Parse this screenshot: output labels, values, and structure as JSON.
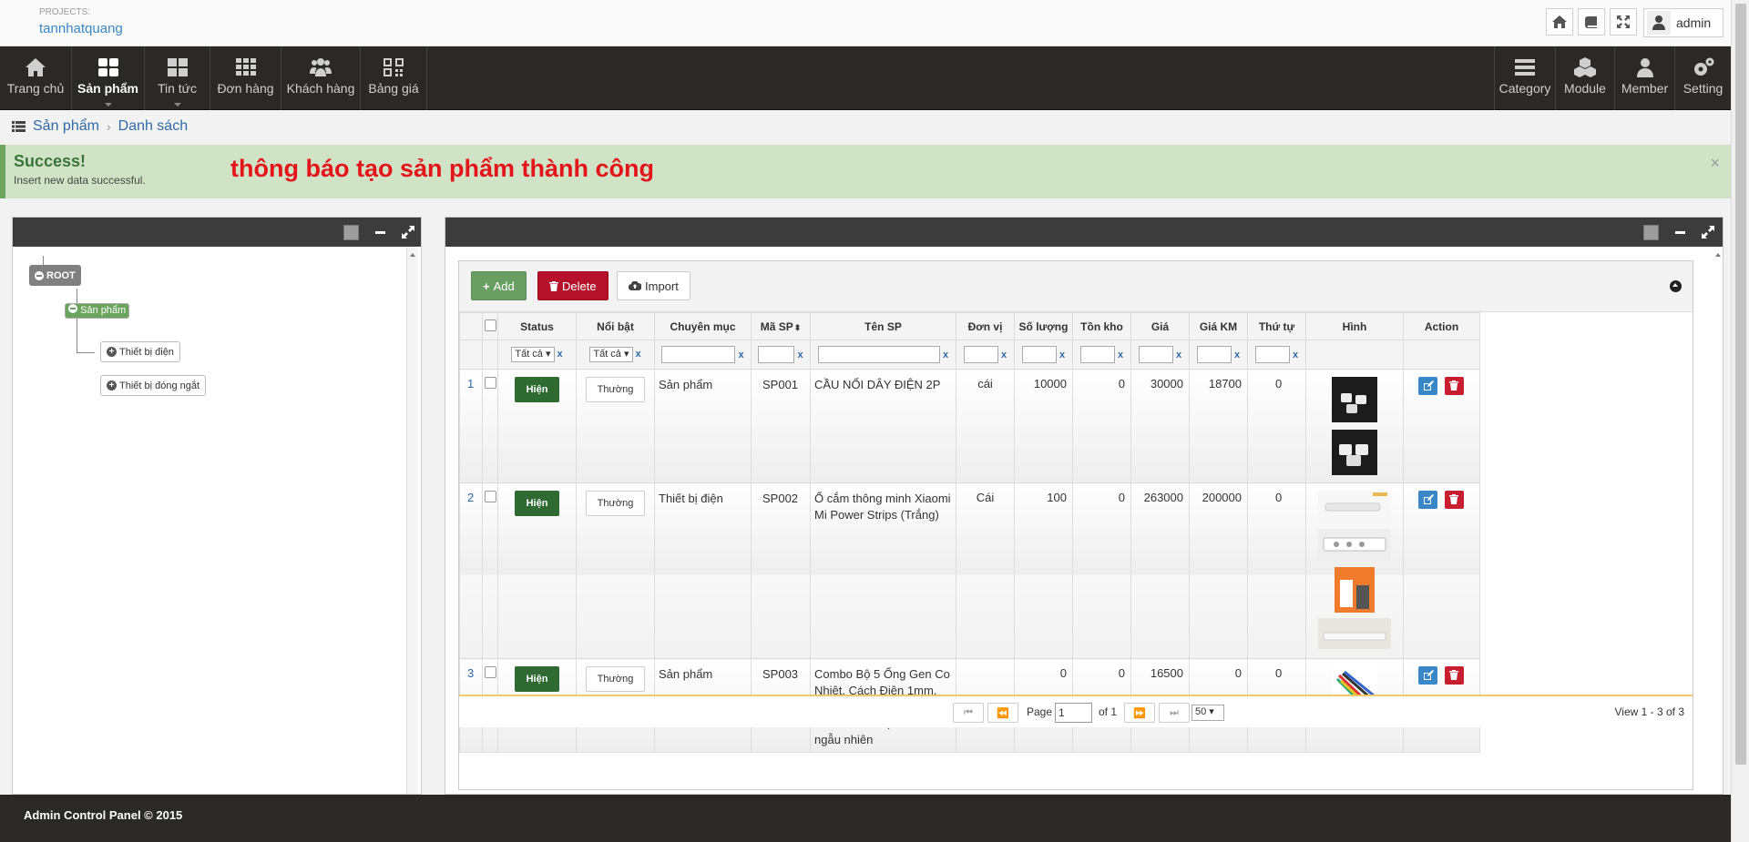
{
  "header": {
    "projects_label": "PROJECTS:",
    "project_name": "tannhatquang",
    "user": "admin"
  },
  "nav": {
    "left": [
      {
        "label": "Trang chủ",
        "icon": "home-icon"
      },
      {
        "label": "Sản phẩm",
        "icon": "dashboard-icon",
        "active": true
      },
      {
        "label": "Tin tức",
        "icon": "grid-icon"
      },
      {
        "label": "Đơn hàng",
        "icon": "apps-icon"
      },
      {
        "label": "Khách hàng",
        "icon": "users-icon"
      },
      {
        "label": "Bảng giá",
        "icon": "qrcode-icon"
      }
    ],
    "right": [
      {
        "label": "Category",
        "icon": "list-icon"
      },
      {
        "label": "Module",
        "icon": "cubes-icon"
      },
      {
        "label": "Member",
        "icon": "user-icon"
      },
      {
        "label": "Setting",
        "icon": "gears-icon"
      }
    ]
  },
  "breadcrumb": {
    "section": "Sản phẩm",
    "page": "Danh sách"
  },
  "alert": {
    "title": "Success!",
    "message": "Insert new data successful.",
    "note": "thông báo tạo sản phẩm thành công",
    "close": "×"
  },
  "tree": {
    "root": "ROOT",
    "selected": "Sản phẩm",
    "children": [
      "Thiết bị điện",
      "Thiết bị đóng ngắt"
    ]
  },
  "toolbar": {
    "add": "Add",
    "delete": "Delete",
    "import": "Import"
  },
  "table": {
    "columns": [
      "Status",
      "Nổi bật",
      "Chuyên mục",
      "Mã SP",
      "Tên SP",
      "Đơn vị",
      "Số lượng",
      "Tồn kho",
      "Giá",
      "Giá KM",
      "Thứ tự",
      "Hình",
      "Action"
    ],
    "filter_all": "Tất cả",
    "filter_clear": "x",
    "rows": [
      {
        "id": "1",
        "status": "Hiện",
        "featured": "Thường",
        "category": "Sản phẩm",
        "code": "SP001",
        "name": "CẦU NỐI DÂY ĐIỆN 2P",
        "unit": "cái",
        "qty": "10000",
        "stock": "0",
        "price": "30000",
        "sale": "18700",
        "order": "0"
      },
      {
        "id": "2",
        "status": "Hiện",
        "featured": "Thường",
        "category": "Thiết bị điện",
        "code": "SP002",
        "name": "Ổ cắm thông minh Xiaomi Mi Power Strips (Trắng)",
        "unit": "Cái",
        "qty": "100",
        "stock": "0",
        "price": "263000",
        "sale": "200000",
        "order": "0"
      },
      {
        "id": "3",
        "status": "Hiện",
        "featured": "Thường",
        "category": "Sản phẩm",
        "code": "SP003",
        "name": "Combo Bộ 5 Ống Gen Co Nhiệt, Cách Điện 1mm, 2mm, 3mm, 4mm, 5mm, Dài 1m Mỗi Sợi - Màu sắc ngẫu nhiên",
        "unit": "",
        "qty": "0",
        "stock": "0",
        "price": "16500",
        "sale": "0",
        "order": "0"
      }
    ]
  },
  "pager": {
    "page_label": "Page",
    "page": "1",
    "of_label": "of 1",
    "per_page": "50",
    "view": "View 1 - 3 of 3"
  },
  "footer": {
    "text": "Admin Control Panel © 2015"
  },
  "colors": {
    "nav": "#2b2926",
    "success": "#d1e3c7",
    "add": "#6a9f63",
    "delete": "#b6112b",
    "show": "#2e6a31"
  }
}
